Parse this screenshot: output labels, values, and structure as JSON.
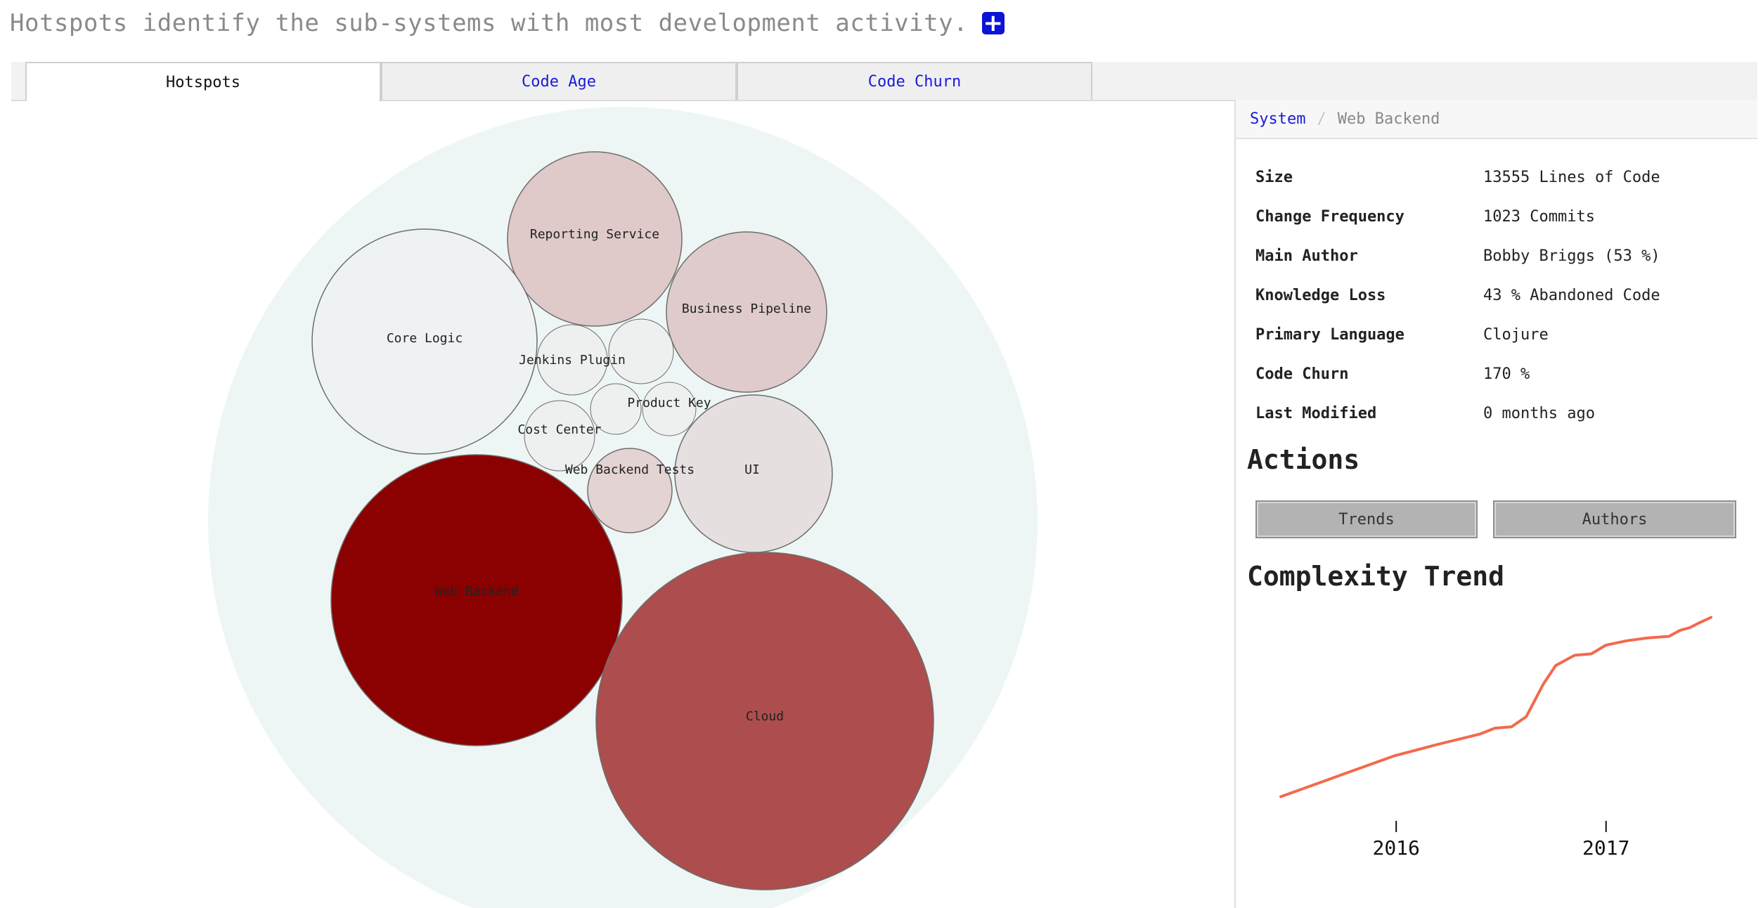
{
  "header": {
    "text": "Hotspots identify the sub-systems with most development activity.",
    "expand_icon": "plus-square-icon",
    "accent": "#0b13d6"
  },
  "tabs": [
    {
      "label": "Hotspots",
      "active": true
    },
    {
      "label": "Code Age",
      "active": false
    },
    {
      "label": "Code Churn",
      "active": false
    }
  ],
  "hotspot_map": {
    "root_color": "#eef6f5",
    "subsystems": [
      {
        "label": "Reporting Service",
        "color": "#dfc9c9"
      },
      {
        "label": "Core Logic",
        "color": "#eef2f2"
      },
      {
        "label": "Business Pipeline",
        "color": "#dfcbcb"
      },
      {
        "label": "Jenkins Plugin",
        "color": "#eef0f0"
      },
      {
        "label": "",
        "color": "#eef0f0"
      },
      {
        "label": "",
        "color": "#eef0f0"
      },
      {
        "label": "Product Key",
        "color": "#eef0f0"
      },
      {
        "label": "Cost Center",
        "color": "#eef0f0"
      },
      {
        "label": "Web Backend Tests",
        "color": "#e3d3d3"
      },
      {
        "label": "UI",
        "color": "#e5dfdf"
      },
      {
        "label": "Web Backend",
        "color": "#8b0000"
      },
      {
        "label": "Cloud",
        "color": "#ad4d4d"
      }
    ]
  },
  "breadcrumb": {
    "root": "System",
    "separator": "/",
    "current": "Web Backend"
  },
  "facts": [
    {
      "label": "Size",
      "value": "13555 Lines of Code"
    },
    {
      "label": "Change Frequency",
      "value": "1023 Commits"
    },
    {
      "label": "Main Author",
      "value": "Bobby Briggs (53 %)"
    },
    {
      "label": "Knowledge Loss",
      "value": "43 % Abandoned Code"
    },
    {
      "label": "Primary Language",
      "value": "Clojure"
    },
    {
      "label": "Code Churn",
      "value": "170 %"
    },
    {
      "label": "Last Modified",
      "value": "0 months ago"
    }
  ],
  "actions": {
    "title": "Actions",
    "trends_label": "Trends",
    "authors_label": "Authors"
  },
  "chart_data": {
    "type": "line",
    "title": "Complexity Trend",
    "xlabel": "",
    "ylabel": "",
    "x_ticks": [
      "2016",
      "2017"
    ],
    "line_color": "#f26a4b",
    "x": [
      2015.45,
      2015.7,
      2015.99,
      2016.2,
      2016.4,
      2016.47,
      2016.55,
      2016.62,
      2016.7,
      2016.76,
      2016.85,
      2016.93,
      2017.0,
      2017.1,
      2017.2,
      2017.3,
      2017.35,
      2017.4,
      2017.44,
      2017.47,
      2017.5
    ],
    "y": [
      0.0,
      0.13,
      0.28,
      0.36,
      0.43,
      0.47,
      0.48,
      0.55,
      0.77,
      0.9,
      0.97,
      0.98,
      1.04,
      1.07,
      1.09,
      1.1,
      1.14,
      1.16,
      1.19,
      1.21,
      1.23
    ],
    "ylim": [
      -0.05,
      1.3
    ]
  }
}
